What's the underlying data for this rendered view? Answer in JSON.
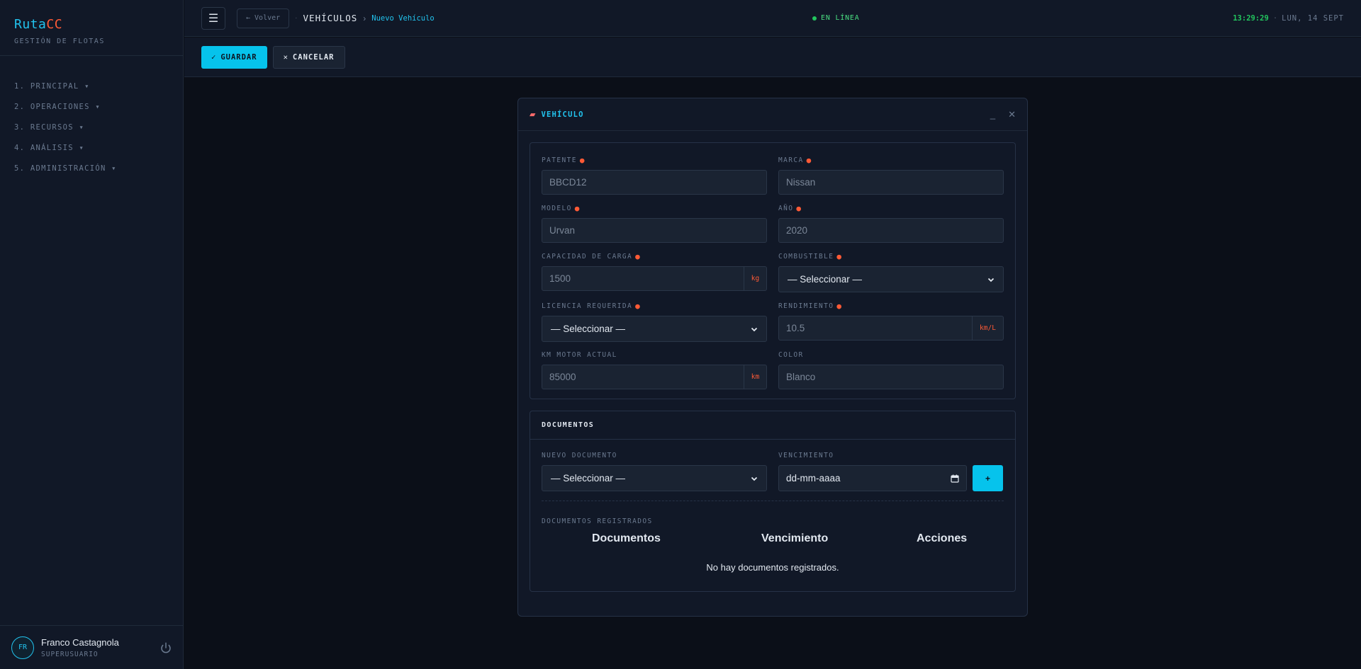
{
  "brand": {
    "name_main": "Ruta",
    "name_accent": "CC",
    "subtitle": "GESTIÓN DE FLOTAS"
  },
  "nav": {
    "items": [
      {
        "label": "1. PRINCIPAL ▾"
      },
      {
        "label": "2. OPERACIONES ▾"
      },
      {
        "label": "3. RECURSOS ▾"
      },
      {
        "label": "4. ANÁLISIS ▾"
      },
      {
        "label": "5. ADMINISTRACIÓN ▾"
      }
    ]
  },
  "user": {
    "initials": "FR",
    "name": "Franco Castagnola",
    "role": "SUPERUSUARIO"
  },
  "topbar": {
    "back_label": "← Volver",
    "crumb_dot": "·",
    "crumb_main": "VEHÍCULOS",
    "crumb_sep": "›",
    "crumb_sub": "Nuevo Vehículo",
    "status": "EN LÍNEA",
    "time": "13:29:29",
    "clock_sep": "·",
    "date": "LUN, 14 SEPT"
  },
  "actions": {
    "save": "GUARDAR",
    "cancel": "CANCELAR"
  },
  "modal": {
    "title": "VEHÍCULO",
    "fields": {
      "patente": {
        "label": "PATENTE",
        "placeholder": "BBCD12"
      },
      "marca": {
        "label": "MARCA",
        "placeholder": "Nissan"
      },
      "modelo": {
        "label": "MODELO",
        "placeholder": "Urvan"
      },
      "anio": {
        "label": "AÑO",
        "placeholder": "2020"
      },
      "capacidad": {
        "label": "CAPACIDAD DE CARGA",
        "placeholder": "1500",
        "unit": "kg"
      },
      "combustible": {
        "label": "COMBUSTIBLE",
        "value": "— Seleccionar —"
      },
      "licencia": {
        "label": "LICENCIA REQUERIDA",
        "value": "— Seleccionar —"
      },
      "rendimiento": {
        "label": "RENDIMIENTO",
        "placeholder": "10.5",
        "unit": "km/L"
      },
      "km_motor": {
        "label": "KM MOTOR ACTUAL",
        "placeholder": "85000",
        "unit": "km"
      },
      "color": {
        "label": "COLOR",
        "placeholder": "Blanco"
      }
    },
    "documents": {
      "title": "DOCUMENTOS",
      "new_doc_label": "NUEVO DOCUMENTO",
      "new_doc_value": "— Seleccionar —",
      "expiry_label": "VENCIMIENTO",
      "expiry_value": "dd-mm-aaaa",
      "add_label": "+",
      "registered_label": "DOCUMENTOS REGISTRADOS",
      "columns": [
        "Documentos",
        "Vencimiento",
        "Acciones"
      ],
      "empty": "No hay documentos registrados."
    }
  }
}
